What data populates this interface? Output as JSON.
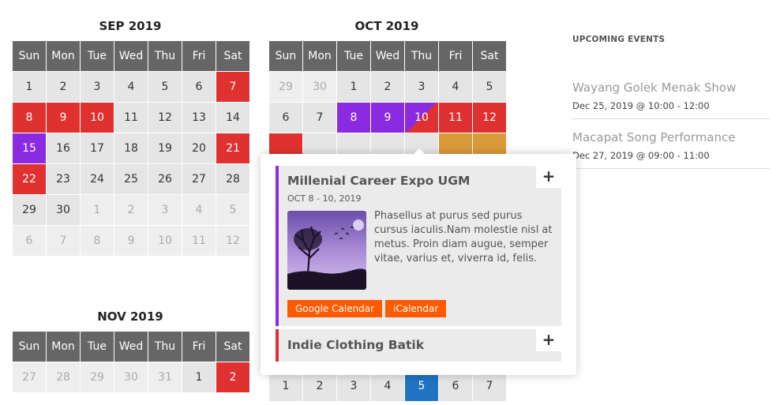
{
  "weekdays": [
    "Sun",
    "Mon",
    "Tue",
    "Wed",
    "Thu",
    "Fri",
    "Sat"
  ],
  "calendars": {
    "sep": {
      "title": "SEP 2019",
      "days": [
        {
          "d": "1",
          "s": ""
        },
        {
          "d": "2",
          "s": ""
        },
        {
          "d": "3",
          "s": ""
        },
        {
          "d": "4",
          "s": ""
        },
        {
          "d": "5",
          "s": ""
        },
        {
          "d": "6",
          "s": ""
        },
        {
          "d": "7",
          "s": "ev-red"
        },
        {
          "d": "8",
          "s": "ev-red"
        },
        {
          "d": "9",
          "s": "ev-red"
        },
        {
          "d": "10",
          "s": "ev-red"
        },
        {
          "d": "11",
          "s": ""
        },
        {
          "d": "12",
          "s": ""
        },
        {
          "d": "13",
          "s": ""
        },
        {
          "d": "14",
          "s": ""
        },
        {
          "d": "15",
          "s": "ev-purple"
        },
        {
          "d": "16",
          "s": ""
        },
        {
          "d": "17",
          "s": ""
        },
        {
          "d": "18",
          "s": ""
        },
        {
          "d": "19",
          "s": ""
        },
        {
          "d": "20",
          "s": ""
        },
        {
          "d": "21",
          "s": "ev-red"
        },
        {
          "d": "22",
          "s": "ev-red"
        },
        {
          "d": "23",
          "s": ""
        },
        {
          "d": "24",
          "s": ""
        },
        {
          "d": "25",
          "s": ""
        },
        {
          "d": "26",
          "s": ""
        },
        {
          "d": "27",
          "s": ""
        },
        {
          "d": "28",
          "s": ""
        },
        {
          "d": "29",
          "s": ""
        },
        {
          "d": "30",
          "s": ""
        },
        {
          "d": "1",
          "s": "muted"
        },
        {
          "d": "2",
          "s": "muted"
        },
        {
          "d": "3",
          "s": "muted"
        },
        {
          "d": "4",
          "s": "muted"
        },
        {
          "d": "5",
          "s": "muted"
        },
        {
          "d": "6",
          "s": "muted"
        },
        {
          "d": "7",
          "s": "muted"
        },
        {
          "d": "8",
          "s": "muted"
        },
        {
          "d": "9",
          "s": "muted"
        },
        {
          "d": "10",
          "s": "muted"
        },
        {
          "d": "11",
          "s": "muted"
        },
        {
          "d": "12",
          "s": "muted"
        }
      ]
    },
    "oct": {
      "title": "OCT 2019",
      "days": [
        {
          "d": "29",
          "s": "muted"
        },
        {
          "d": "30",
          "s": "muted"
        },
        {
          "d": "1",
          "s": ""
        },
        {
          "d": "2",
          "s": ""
        },
        {
          "d": "3",
          "s": ""
        },
        {
          "d": "4",
          "s": ""
        },
        {
          "d": "5",
          "s": ""
        },
        {
          "d": "6",
          "s": ""
        },
        {
          "d": "7",
          "s": ""
        },
        {
          "d": "8",
          "s": "ev-purple"
        },
        {
          "d": "9",
          "s": "ev-purple"
        },
        {
          "d": "10",
          "s": "ev-split"
        },
        {
          "d": "11",
          "s": "ev-red"
        },
        {
          "d": "12",
          "s": "ev-red"
        },
        {
          "d": "",
          "s": "ev-red"
        },
        {
          "d": "",
          "s": ""
        },
        {
          "d": "",
          "s": ""
        },
        {
          "d": "",
          "s": ""
        },
        {
          "d": "",
          "s": ""
        },
        {
          "d": "",
          "s": "ev-orange"
        },
        {
          "d": "",
          "s": "ev-orange"
        }
      ]
    },
    "nov": {
      "title": "NOV 2019",
      "days": [
        {
          "d": "27",
          "s": "muted"
        },
        {
          "d": "28",
          "s": "muted"
        },
        {
          "d": "29",
          "s": "muted"
        },
        {
          "d": "30",
          "s": "muted"
        },
        {
          "d": "31",
          "s": "muted"
        },
        {
          "d": "1",
          "s": ""
        },
        {
          "d": "2",
          "s": "ev-red"
        }
      ]
    },
    "dec": {
      "days": [
        {
          "d": "1",
          "s": ""
        },
        {
          "d": "2",
          "s": ""
        },
        {
          "d": "3",
          "s": ""
        },
        {
          "d": "4",
          "s": ""
        },
        {
          "d": "5",
          "s": "ev-blue"
        },
        {
          "d": "6",
          "s": ""
        },
        {
          "d": "7",
          "s": ""
        }
      ]
    }
  },
  "upcoming": {
    "title": "UPCOMING EVENTS",
    "items": [
      {
        "name": "Wayang Golek Menak Show",
        "date": "Dec 25, 2019 @ 10:00 - 12:00"
      },
      {
        "name": "Macapat Song Performance",
        "date": "Dec 27, 2019 @ 09:00 - 11:00"
      }
    ]
  },
  "popup": {
    "events": [
      {
        "title": "Millenial Career Expo UGM",
        "date": "OCT 8 - 10, 2019",
        "description": "Phasellus at purus sed purus cursus iaculis.Nam molestie nisl at metus. Proin diam augue, semper vitae, varius et, viverra id, felis.",
        "gcal_label": "Google Calendar",
        "ical_label": "iCalendar",
        "expand_label": "+",
        "color": "#8a2be2"
      },
      {
        "title": "Indie Clothing Batik",
        "expand_label": "+",
        "color": "#e03131"
      }
    ]
  },
  "colors": {
    "header": "#666666",
    "event_red": "#e03131",
    "event_purple": "#8a2be2",
    "event_orange": "#d99a3a",
    "event_blue": "#1f73c2",
    "button": "#ff5a00"
  }
}
